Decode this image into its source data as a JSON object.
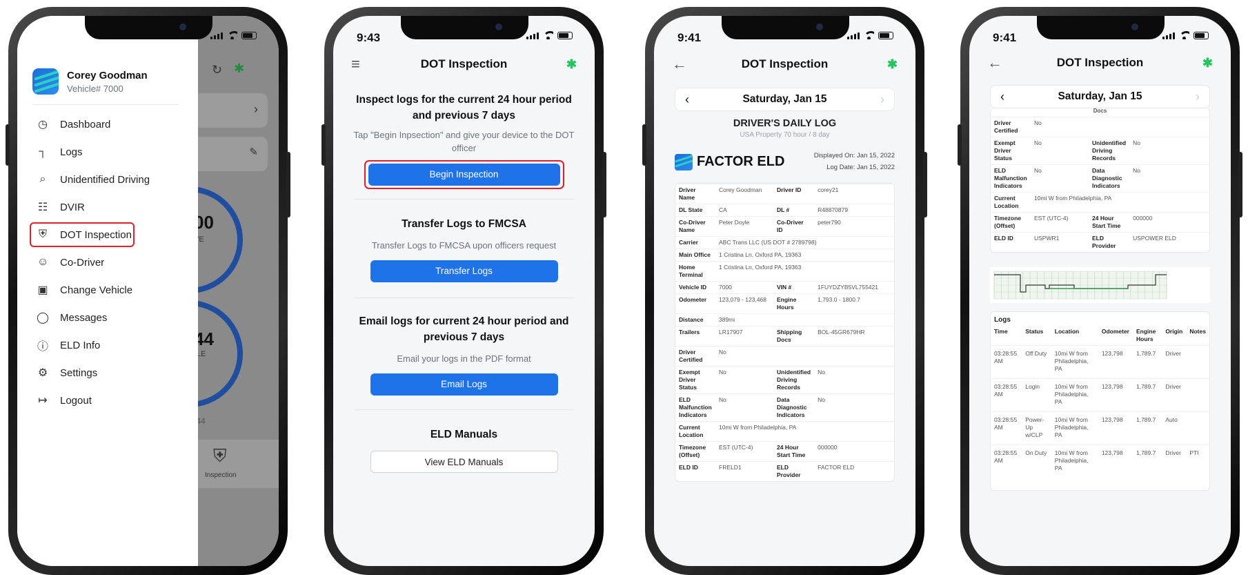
{
  "status": {
    "time2": "9:43",
    "time3": "9:41",
    "time4": "9:41"
  },
  "menu": {
    "name": "Corey Goodman",
    "vehicle": "Vehicle# 7000",
    "items": [
      {
        "label": "Dashboard",
        "icon": "clock-icon"
      },
      {
        "label": "Logs",
        "icon": "logs-icon"
      },
      {
        "label": "Unidentified Driving",
        "icon": "search-icon"
      },
      {
        "label": "DVIR",
        "icon": "clipboard-icon"
      },
      {
        "label": "DOT Inspection",
        "icon": "shield-icon"
      },
      {
        "label": "Co-Driver",
        "icon": "users-icon"
      },
      {
        "label": "Change Vehicle",
        "icon": "truck-icon"
      },
      {
        "label": "Messages",
        "icon": "message-icon"
      },
      {
        "label": "ELD Info",
        "icon": "info-icon"
      },
      {
        "label": "Settings",
        "icon": "gear-icon"
      },
      {
        "label": "Logout",
        "icon": "logout-icon"
      }
    ],
    "bg": {
      "big1": "00",
      "sub1": "VE",
      "big2": "44",
      "sub2": "CLE",
      "mini": ":44",
      "tab": "Inspection"
    }
  },
  "dot": {
    "title": "DOT Inspection",
    "s1": {
      "head": "Inspect logs for the current 24 hour period and previous 7 days",
      "body": "Tap \"Begin Inpsection\" and give your device to the DOT officer",
      "btn": "Begin Inspection"
    },
    "s2": {
      "head": "Transfer Logs to FMCSA",
      "body": "Transfer Logs to FMCSA upon officers request",
      "btn": "Transfer Logs"
    },
    "s3": {
      "head": "Email logs for current 24 hour period and previous 7 days",
      "body": "Email your logs in the PDF format",
      "btn": "Email Logs"
    },
    "s4": {
      "head": "ELD Manuals",
      "btn": "View ELD Manuals"
    }
  },
  "log": {
    "title": "DOT Inspection",
    "date": "Saturday, Jan 15",
    "heading": "DRIVER'S DAILY LOG",
    "sub": "USA Property 70 hour / 8 day",
    "brand": "FACTOR ELD",
    "displayed": "Displayed On: Jan 15, 2022",
    "logdate": "Log Date: Jan 15, 2022",
    "rows": [
      [
        "Driver Name",
        "Corey Goodman",
        "Driver ID",
        "corey21"
      ],
      [
        "DL State",
        "CA",
        "DL #",
        "R48870879"
      ],
      [
        "Co-Driver Name",
        "Peter Doyle",
        "Co-Driver ID",
        "peter790"
      ],
      [
        "Carrier",
        "ABC Trans LLC (US DOT # 2789798)",
        "",
        ""
      ],
      [
        "Main Office",
        "1 Cristina Ln, Oxford PA, 19363",
        "",
        ""
      ],
      [
        "Home Terminal",
        "1 Cristina Ln, Oxford PA, 19363",
        "",
        ""
      ],
      [
        "Vehicle ID",
        "7000",
        "VIN #",
        "1FUYDZYB5VL755421"
      ],
      [
        "Odometer",
        "123,079 - 123,468",
        "Engine Hours",
        "1,793.0 - 1800.7"
      ],
      [
        "Distance",
        "389mi",
        "",
        ""
      ],
      [
        "Trailers",
        "LR17907",
        "Shipping Docs",
        "BOL-45GR679HR"
      ],
      [
        "Driver Certified",
        "No",
        "",
        ""
      ],
      [
        "Exempt Driver Status",
        "No",
        "Unidentified Driving Records",
        "No"
      ],
      [
        "ELD Malfunction Indicators",
        "No",
        "Data Diagnostic Indicators",
        "No"
      ],
      [
        "Current Location",
        "10mi W from Philadelphia, PA",
        "",
        ""
      ],
      [
        "Timezone (Offset)",
        "EST (UTC-4)",
        "24 Hour Start Time",
        "000000"
      ],
      [
        "ELD ID",
        "FRELD1",
        "ELD Provider",
        "FACTOR ELD"
      ]
    ]
  },
  "log2": {
    "title": "DOT Inspection",
    "date": "Saturday, Jan 15",
    "cut": "Docs",
    "rows": [
      [
        "Driver Certified",
        "No",
        "",
        ""
      ],
      [
        "Exempt Driver Status",
        "No",
        "Unidentified Driving Records",
        "No"
      ],
      [
        "ELD Malfunction Indicators",
        "No",
        "Data Diagnostic Indicators",
        "No"
      ],
      [
        "Current Location",
        "10mi W from Philadelphia, PA",
        "",
        ""
      ],
      [
        "Timezone (Offset)",
        "EST (UTC-4)",
        "24 Hour Start Time",
        "000000"
      ],
      [
        "ELD ID",
        "USPWR1",
        "ELD Provider",
        "USPOWER ELD"
      ]
    ],
    "logs_title": "Logs",
    "cols": [
      "Time",
      "Status",
      "Location",
      "Odometer",
      "Engine Hours",
      "Origin",
      "Notes"
    ],
    "entries": [
      [
        "03:28:55 AM",
        "Off Duty",
        "10mi W from Philadelphia, PA",
        "123,798",
        "1,789.7",
        "Driver",
        ""
      ],
      [
        "03:28:55 AM",
        "Login",
        "10mi W from Philadelphia, PA",
        "123,798",
        "1,789.7",
        "Driver",
        ""
      ],
      [
        "03:28:55 AM",
        "Power-Up w/CLP",
        "10mi W from Philadelphia, PA",
        "123,798",
        "1,789.7",
        "Auto",
        ""
      ],
      [
        "03:28:55 AM",
        "On Duty",
        "10mi W from Philadelphia, PA",
        "123,798",
        "1,789.7",
        "Driver",
        "PTI"
      ]
    ]
  }
}
